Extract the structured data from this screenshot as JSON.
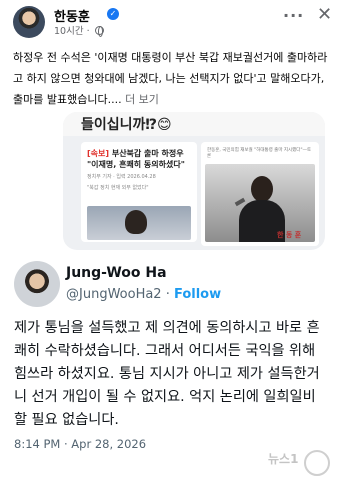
{
  "post": {
    "author": "한동훈",
    "time": "10시간",
    "text": "하정우 전 수석은 '이재명 대통령이 부산 북갑 재보궐선거에 출마하라고 하지 않으면 청와대에 남겠다, 나는 선택지가 없다'고 말해오다가, 출마를 발표했습니다.... ",
    "see_more": "더 보기"
  },
  "image": {
    "headline": "들이십니까⁉😊",
    "article_title_tag": "[속보]",
    "article_title": " 부산북갑 출마 하정우 \"이재명, 흔쾌히 동의하셨다\"",
    "article_sub": "정치부 기자 · 입력 2026.04.28",
    "article_sub2": "\"북갑 정치 현재 외부 없었다\"",
    "side_text": "한동훈, 국민의힘 재보궐 \"하대통령 출마 지시했다\"—토론",
    "side_caption": "한 동 훈"
  },
  "tweet": {
    "name": "Jung-Woo Ha",
    "handle": "@JungWooHa2",
    "separator": " · ",
    "follow": "Follow",
    "text": "제가 통님을 설득했고 제 의견에 동의하시고 바로 흔쾌히 수락하셨습니다. 그래서 어디서든 국익을 위해 힘쓰라 하셨지요. 통님 지시가 아니고 제가 설득한거니 선거 개입이 될 수 없지요. 억지 논리에 일희일비 할 필요 없습니다.",
    "date": "8:14 PM · Apr 28, 2026"
  },
  "watermark": "뉴스1",
  "colors": {
    "verified": "#1877f2",
    "follow": "#1d9bf0",
    "secondary": "#65676b"
  }
}
